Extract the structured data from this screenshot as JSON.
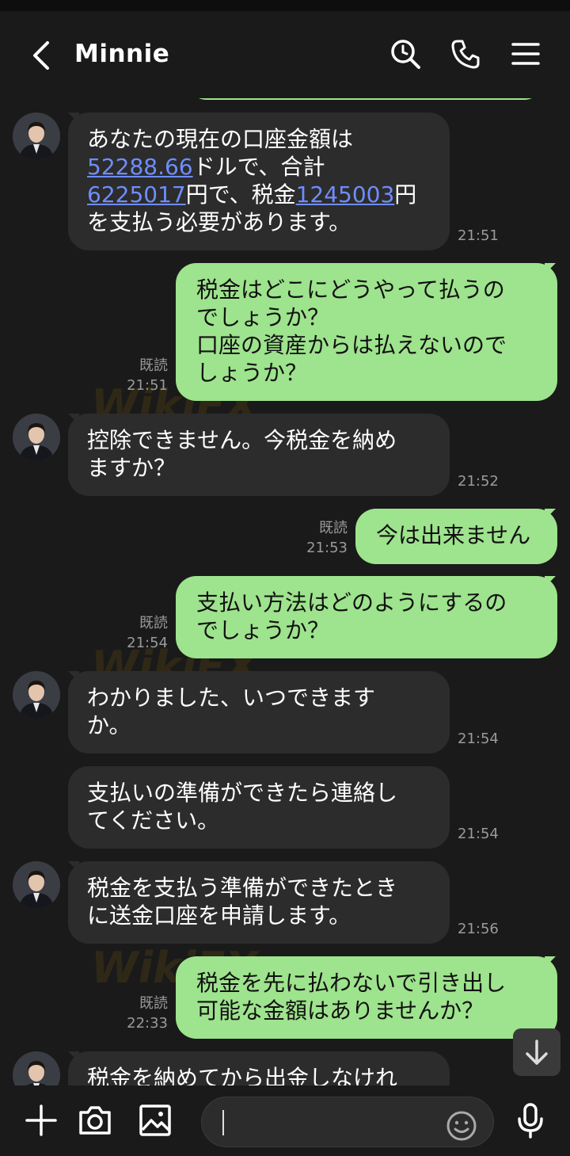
{
  "header": {
    "title": "Minnie"
  },
  "messages": [
    {
      "id": "m1",
      "text_prefix": "あなたの現在の口座金額は",
      "link1": "52288.66",
      "text_mid1": "ドルで、合計",
      "link2": "6225017",
      "text_mid2": "円で、税金",
      "link3": "1245003",
      "text_mid3": "円",
      "text_end": "を支払う必要があります。",
      "time": "21:51"
    },
    {
      "id": "m2",
      "line1": "税金はどこにどうやって払うの",
      "line2": "でしょうか？",
      "line3": "口座の資産からは払えないので",
      "line4": "しょうか？",
      "read": "既読",
      "time": "21:51"
    },
    {
      "id": "m3",
      "line1": "控除できません。今税金を納め",
      "line2": "ますか？",
      "time": "21:52"
    },
    {
      "id": "m4",
      "line1": "今は出来ません",
      "read": "既読",
      "time": "21:53"
    },
    {
      "id": "m5",
      "line1": "支払い方法はどのようにするの",
      "line2": "でしょうか？",
      "read": "既読",
      "time": "21:54"
    },
    {
      "id": "m6",
      "line1": "わかりました、いつできます",
      "line2": "か。",
      "time": "21:54"
    },
    {
      "id": "m7",
      "line1": "支払いの準備ができたら連絡し",
      "line2": "てください。",
      "time": "21:54"
    },
    {
      "id": "m8",
      "line1": "税金を支払う準備ができたとき",
      "line2": "に送金口座を申請します。",
      "time": "21:56"
    },
    {
      "id": "m9",
      "line1": "税金を先に払わないで引き出し",
      "line2": "可能な金額はありませんか？",
      "read": "既読",
      "time": "22:33"
    },
    {
      "id": "m10",
      "line1": "税金を納めてから出金しなけれ"
    }
  ],
  "watermark": "WikiFX",
  "icons": {
    "back": "chevron-left-icon",
    "search": "search-icon",
    "call": "phone-icon",
    "menu": "hamburger-menu-icon",
    "scroll": "arrow-down-icon",
    "add": "plus-icon",
    "camera": "camera-icon",
    "gallery": "image-icon",
    "emoji": "emoji-icon",
    "mic": "microphone-icon"
  },
  "colors": {
    "background": "#1a1a1a",
    "incoming_bubble": "#2c2c2c",
    "outgoing_bubble": "#9ee38d",
    "link": "#6f8dff",
    "meta_text": "#9a9a9a"
  }
}
